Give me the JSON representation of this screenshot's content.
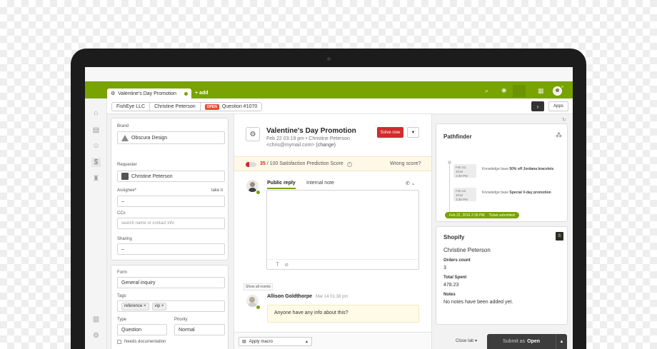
{
  "tabs": {
    "active_label": "Valentine's Day Promotion",
    "add_label": "add"
  },
  "breadcrumbs": {
    "org": "FishEye LLC",
    "requester": "Christine Peterson",
    "status": "OPEN",
    "ticket": "Question #1070"
  },
  "toolbar": {
    "next_symbol": "›",
    "apps_label": "Apps"
  },
  "properties": {
    "brand_label": "Brand",
    "brand_value": "Obscura Design",
    "requester_label": "Requester",
    "requester_value": "Christine Peterson",
    "assignee_label": "Assignee*",
    "assignee_link": "take it",
    "assignee_value": "–",
    "ccs_label": "CCs",
    "ccs_placeholder": "search name or contact info",
    "sharing_label": "Sharing",
    "sharing_value": "–",
    "form_label": "Form",
    "form_value": "General inquiry",
    "tags_label": "Tags",
    "tags": [
      "reference",
      "vip"
    ],
    "type_label": "Type",
    "type_value": "Question",
    "priority_label": "Priority",
    "priority_value": "Normal",
    "needs_doc_label": "Needs documentation"
  },
  "ticket": {
    "subject": "Valentine's Day Promotion",
    "date": "Feb 22 03:19 pm",
    "author": "Christine Peterson",
    "email": "<chris@mymail.com>",
    "change_link": "(change)",
    "solve_label": "Solve now",
    "satisfaction_score": "35",
    "satisfaction_text": "/ 100 Satisfaction Prediction Score",
    "satisfaction_fraction": 0.35,
    "wrong_score": "Wrong score?",
    "reply_tab_public": "Public reply",
    "reply_tab_internal": "Internal note",
    "show_events": "Show all events",
    "event_author": "Allison Goldthorpe",
    "event_time": "Mar 14 01:38 pm",
    "event_message": "Anyone have any info about this?",
    "macro_label": "Apply macro",
    "close_tab": "Close tab",
    "submit_prefix": "Submit as",
    "submit_status": "Open"
  },
  "pathfinder": {
    "title": "Pathfinder",
    "events": [
      {
        "date1": "Feb 22,",
        "date2": "2016",
        "date3": "2:39 PM",
        "prefix": "Knowledge base",
        "title": "50% off Jordana bracelets"
      },
      {
        "date1": "Feb 22,",
        "date2": "2016",
        "date3": "2:38 PM",
        "prefix": "Knowledge base",
        "title": "Special V-day promotion"
      }
    ],
    "submitted_date": "Feb 22, 2016 2:39 PM",
    "submitted_label": "Ticket submitted"
  },
  "shopify": {
    "title": "Shopify",
    "logo_text": "S",
    "customer": "Christine Peterson",
    "orders_label": "Orders count",
    "orders_value": "3",
    "spent_label": "Total Spent",
    "spent_value": "478.23",
    "notes_label": "Notes",
    "notes_value": "No notes have been added yet."
  },
  "colors": {
    "brand_green": "#78a300",
    "solve_red": "#d22b2b",
    "open_badge": "#e34f32"
  }
}
